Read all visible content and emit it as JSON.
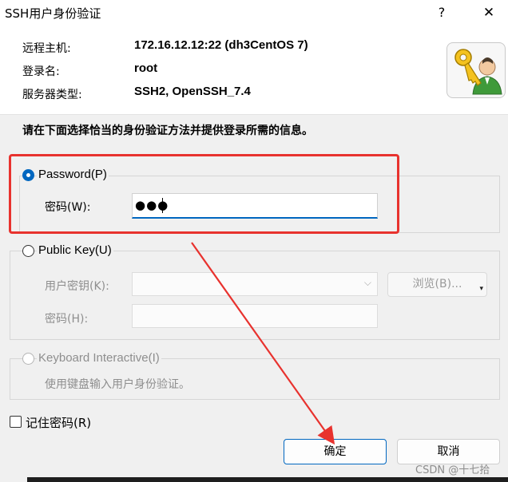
{
  "window": {
    "title": "SSH用户身份验证",
    "help_glyph": "?",
    "close_glyph": "✕"
  },
  "info": {
    "host_label": "远程主机:",
    "host_value": "172.16.12.12:22 (dh3CentOS 7)",
    "login_label": "登录名:",
    "login_value": "root",
    "server_type_label": "服务器类型:",
    "server_type_value": "SSH2, OpenSSH_7.4"
  },
  "instruction": "请在下面选择恰当的身份验证方法并提供登录所需的信息。",
  "password_method": {
    "label": "Password(P)",
    "selected": true,
    "password_label": "密码(W):",
    "password_value": "●●●"
  },
  "public_key_method": {
    "label": "Public Key(U)",
    "selected": false,
    "user_key_label": "用户密钥(K):",
    "user_key_value": "",
    "browse_label": "浏览(B)...",
    "passphrase_label": "密码(H):",
    "passphrase_value": ""
  },
  "keyboard_method": {
    "label": "Keyboard Interactive(I)",
    "selected": false,
    "description": "使用键盘输入用户身份验证。"
  },
  "remember_password": {
    "label": "记住密码(R)",
    "checked": false
  },
  "buttons": {
    "ok": "确定",
    "cancel": "取消"
  },
  "annotation": {
    "highlight_color": "#e8322e"
  },
  "watermark": "CSDN @十七拾",
  "colors": {
    "accent": "#0067c0",
    "dialog_bg": "#f0f0f0",
    "annotation_red": "#e8322e"
  }
}
